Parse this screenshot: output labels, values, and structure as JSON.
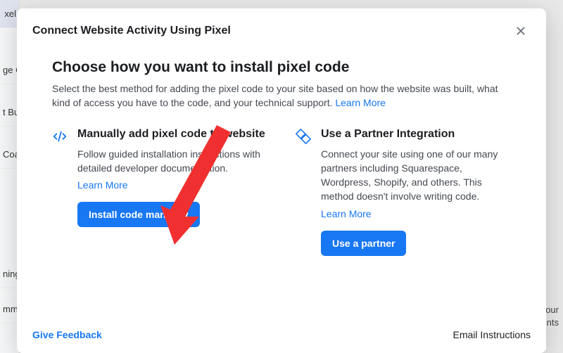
{
  "colors": {
    "primary": "#1877f2",
    "text": "#1c1e21",
    "muted": "#444950"
  },
  "sidebar": {
    "items": [
      "xel",
      "ge C",
      "t Bu",
      "Coa",
      "",
      "ning",
      "mme"
    ]
  },
  "right_bg": {
    "line1": "your",
    "line2": "vents"
  },
  "modal": {
    "title": "Connect Website Activity Using Pixel",
    "heading": "Choose how you want to install pixel code",
    "description": "Select the best method for adding the pixel code to your site based on how the website was built, what kind of access you have to the code, and your technical support.",
    "learn_more": "Learn More",
    "options": [
      {
        "icon": "code-icon",
        "title": "Manually add pixel code to website",
        "desc": "Follow guided installation instructions with detailed developer documentation.",
        "learn": "Learn More",
        "cta": "Install code manually"
      },
      {
        "icon": "partner-icon",
        "title": "Use a Partner Integration",
        "desc": "Connect your site using one of our many partners including Squarespace, Wordpress, Shopify, and others. This method doesn't involve writing code.",
        "learn": "Learn More",
        "cta": "Use a partner"
      }
    ],
    "footer": {
      "feedback": "Give Feedback",
      "email": "Email Instructions"
    }
  }
}
